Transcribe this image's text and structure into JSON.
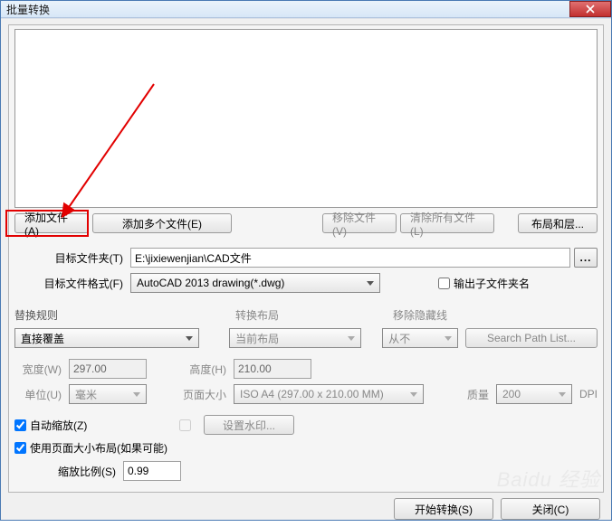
{
  "title": "批量转换",
  "buttons": {
    "add_file": "添加文件(A)",
    "add_multi": "添加多个文件(E)",
    "remove_file": "移除文件(V)",
    "clear_all": "清除所有文件(L)",
    "layout_layers": "布局和层...",
    "browse": "...",
    "set_watermark": "设置水印...",
    "search_path": "Search Path List...",
    "start": "开始转换(S)",
    "close": "关闭(C)"
  },
  "labels": {
    "target_folder": "目标文件夹(T)",
    "target_format": "目标文件格式(F)",
    "output_subfolder": "输出子文件夹名",
    "replace_rule": "替换规则",
    "convert_layout": "转换布局",
    "remove_hidden": "移除隐藏线",
    "width": "宽度(W)",
    "height": "高度(H)",
    "unit": "单位(U)",
    "page_size": "页面大小",
    "quality": "质量",
    "auto_zoom": "自动缩放(Z)",
    "use_page_layout": "使用页面大小布局(如果可能)",
    "zoom_ratio": "缩放比例(S)",
    "dpi": "DPI"
  },
  "values": {
    "target_folder": "E:\\jixiewenjian\\CAD文件",
    "target_format": "AutoCAD 2013 drawing(*.dwg)",
    "replace_rule": "直接覆盖",
    "convert_layout": "当前布局",
    "remove_hidden": "从不",
    "width": "297.00",
    "height": "210.00",
    "unit": "毫米",
    "page_size": "ISO A4 (297.00 x 210.00 MM)",
    "quality": "200",
    "zoom_ratio": "0.99"
  },
  "watermark": "Baidu 经验"
}
